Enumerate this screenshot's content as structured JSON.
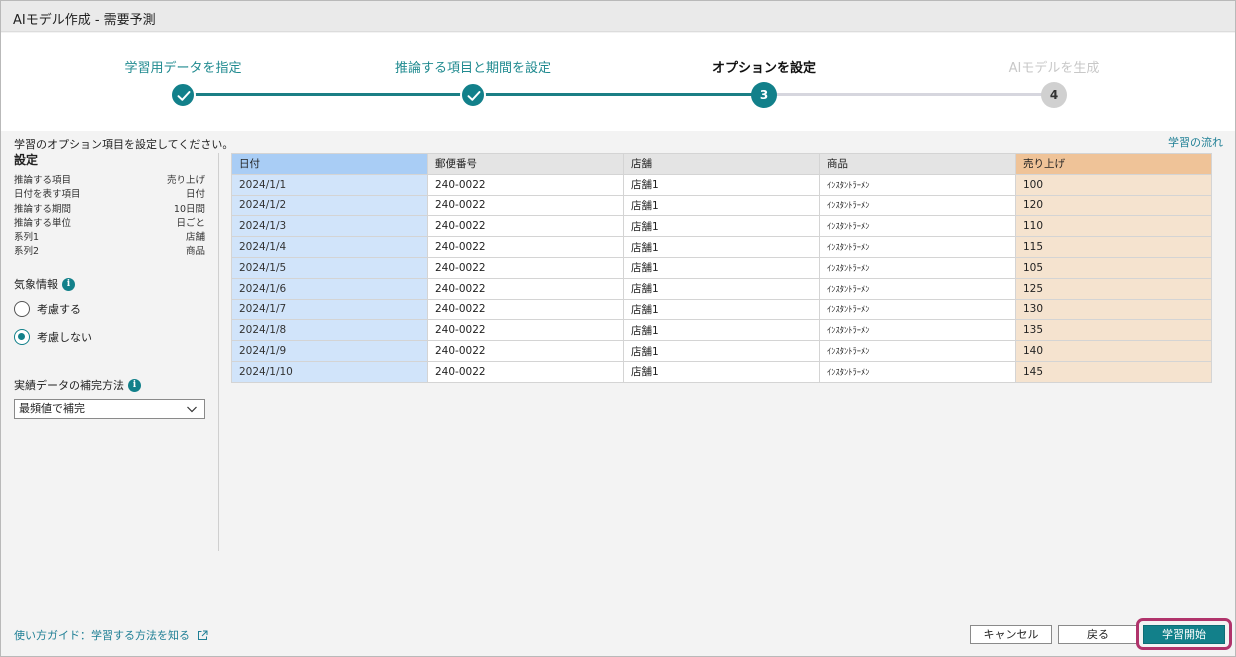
{
  "window": {
    "title": "AIモデル作成 - 需要予測"
  },
  "steps": [
    {
      "label": "学習用データを指定",
      "state": "done",
      "number": ""
    },
    {
      "label": "推論する項目と期間を設定",
      "state": "done",
      "number": ""
    },
    {
      "label": "オプションを設定",
      "state": "active",
      "number": "3"
    },
    {
      "label": "AIモデルを生成",
      "state": "future",
      "number": "4"
    }
  ],
  "instruction": "学習のオプション項目を設定してください。",
  "learning_flow_link": "学習の流れ",
  "settings": {
    "heading": "設定",
    "rows": [
      {
        "key": "推論する項目",
        "value": "売り上げ"
      },
      {
        "key": "日付を表す項目",
        "value": "日付"
      },
      {
        "key": "推論する期間",
        "value": "10日間"
      },
      {
        "key": "推論する単位",
        "value": "日ごと"
      },
      {
        "key": "系列1",
        "value": "店舗"
      },
      {
        "key": "系列2",
        "value": "商品"
      }
    ]
  },
  "weather": {
    "label": "気象情報",
    "info_icon": "info-icon",
    "options": [
      {
        "label": "考慮する",
        "selected": false
      },
      {
        "label": "考慮しない",
        "selected": true
      }
    ]
  },
  "fill_method": {
    "label": "実績データの補完方法",
    "info_icon": "info-icon",
    "selected": "最頻値で補完"
  },
  "table": {
    "columns": [
      "日付",
      "郵便番号",
      "店舗",
      "商品",
      "売り上げ"
    ],
    "rows": [
      [
        "2024/1/1",
        "240-0022",
        "店舗1",
        "ｲﾝｽﾀﾝﾄﾗｰﾒﾝ",
        "100"
      ],
      [
        "2024/1/2",
        "240-0022",
        "店舗1",
        "ｲﾝｽﾀﾝﾄﾗｰﾒﾝ",
        "120"
      ],
      [
        "2024/1/3",
        "240-0022",
        "店舗1",
        "ｲﾝｽﾀﾝﾄﾗｰﾒﾝ",
        "110"
      ],
      [
        "2024/1/4",
        "240-0022",
        "店舗1",
        "ｲﾝｽﾀﾝﾄﾗｰﾒﾝ",
        "115"
      ],
      [
        "2024/1/5",
        "240-0022",
        "店舗1",
        "ｲﾝｽﾀﾝﾄﾗｰﾒﾝ",
        "105"
      ],
      [
        "2024/1/6",
        "240-0022",
        "店舗1",
        "ｲﾝｽﾀﾝﾄﾗｰﾒﾝ",
        "125"
      ],
      [
        "2024/1/7",
        "240-0022",
        "店舗1",
        "ｲﾝｽﾀﾝﾄﾗｰﾒﾝ",
        "130"
      ],
      [
        "2024/1/8",
        "240-0022",
        "店舗1",
        "ｲﾝｽﾀﾝﾄﾗｰﾒﾝ",
        "135"
      ],
      [
        "2024/1/9",
        "240-0022",
        "店舗1",
        "ｲﾝｽﾀﾝﾄﾗｰﾒﾝ",
        "140"
      ],
      [
        "2024/1/10",
        "240-0022",
        "店舗1",
        "ｲﾝｽﾀﾝﾄﾗｰﾒﾝ",
        "145"
      ]
    ]
  },
  "footer": {
    "guide_link": "使い方ガイド：学習する方法を知る",
    "external_icon": "external-link-icon",
    "cancel_label": "キャンセル",
    "back_label": "戻る",
    "start_label": "学習開始"
  },
  "colors": {
    "accent": "#12808a",
    "link": "#1f7f95",
    "date_column": "#d1e4fa",
    "target_column": "#f5e3cf",
    "highlight": "#b0336b"
  }
}
